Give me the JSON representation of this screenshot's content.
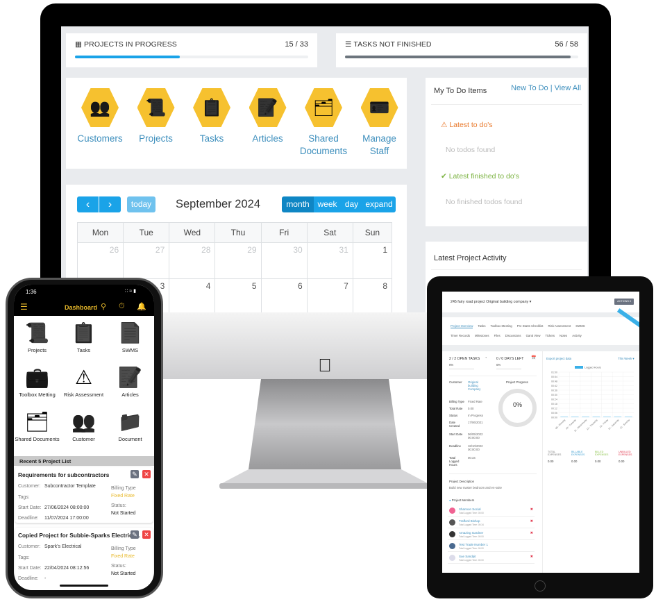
{
  "desktop": {
    "stats": [
      {
        "icon": "cubes-icon",
        "label": "PROJECTS IN PROGRESS",
        "value": "15 / 33",
        "progress": 0.45,
        "color": "#1aa3e8"
      },
      {
        "icon": "tasks-bars-icon",
        "label": "TASKS NOT FINISHED",
        "value": "56 / 58",
        "progress": 0.966,
        "color": "#6c757d"
      }
    ],
    "shortcuts": [
      {
        "label": "Customers",
        "icon": "customers-icon"
      },
      {
        "label": "Projects",
        "icon": "projects-icon"
      },
      {
        "label": "Tasks",
        "icon": "tasks-icon"
      },
      {
        "label": "Articles",
        "icon": "articles-icon"
      },
      {
        "label": "Shared Documents",
        "icon": "shared-documents-icon"
      },
      {
        "label": "Manage Staff",
        "icon": "manage-staff-icon"
      }
    ],
    "todo": {
      "title": "My To Do Items",
      "new_todo": "New To Do",
      "separator": "|",
      "view_all": "View All",
      "latest": "Latest to do's",
      "no_todos": "No todos found",
      "finished": "Latest finished to do's",
      "no_finished": "No finished todos found"
    },
    "activity": {
      "title": "Latest Project Activity"
    },
    "calendar": {
      "prev": "‹",
      "next": "›",
      "today": "today",
      "title": "September 2024",
      "views": [
        "month",
        "week",
        "day",
        "expand"
      ],
      "active_view": "month",
      "weekdays": [
        "Mon",
        "Tue",
        "Wed",
        "Thu",
        "Fri",
        "Sat",
        "Sun"
      ],
      "weeks": [
        [
          "26",
          "27",
          "28",
          "29",
          "30",
          "31",
          "1"
        ],
        [
          "",
          "3",
          "4",
          "5",
          "6",
          "7",
          "8"
        ]
      ]
    }
  },
  "phone": {
    "time": "1:36",
    "title": "Dashboard",
    "tiles": [
      {
        "label": "Projects",
        "icon": "projects-icon"
      },
      {
        "label": "Tasks",
        "icon": "tasks-icon"
      },
      {
        "label": "SWMS",
        "icon": "swms-icon"
      },
      {
        "label": "Toolbox Metting",
        "icon": "toolbox-icon"
      },
      {
        "label": "Risk Assessment",
        "icon": "warning-icon"
      },
      {
        "label": "Articles",
        "icon": "articles-icon"
      },
      {
        "label": "Shared Documents",
        "icon": "shared-documents-icon"
      },
      {
        "label": "Customer",
        "icon": "customers-icon"
      },
      {
        "label": "Document",
        "icon": "folder-icon"
      }
    ],
    "section": "Recent 5 Project List",
    "labels": {
      "customer": "Customer:",
      "tags": "Tags:",
      "start": "Start Date:",
      "deadline": "Deadline:",
      "billing": "Billing Type",
      "status": "Status:"
    },
    "projects": [
      {
        "title": "Requirements for subcontractors",
        "customer": "Subcontractor Template",
        "start": "27/06/2024 08:00:00",
        "deadline": "11/07/2024 17:00:00",
        "billing": "Fixed Rate",
        "status": "Not Started"
      },
      {
        "title": "Copied Project for Subbie-Sparks Electrica...",
        "customer": "Spark's Electrical",
        "start": "22/04/2024 08:12:56",
        "deadline": "-",
        "billing": "Fixed Rate",
        "status": "Not Started"
      }
    ],
    "accent": "#e8b92b"
  },
  "tablet": {
    "title": "245 fairy road project Original building company",
    "title_caret": "▾",
    "actions": "ACTIONS ▾",
    "tabs_row1": [
      "Project Overview",
      "Tasks",
      "Toolbox Meeting",
      "Pre Starts Checklist",
      "Risk Assessment",
      "SWMS"
    ],
    "tabs_row2": [
      "Timer Records",
      "Milestones",
      "Files",
      "Discussions",
      "Gantt View",
      "Tickets",
      "Notes",
      "Activity"
    ],
    "open_tasks": {
      "label": "2 / 2 OPEN TASKS",
      "pct": "0%"
    },
    "days_left": {
      "label": "0 / 0 DAYS LEFT",
      "pct": "0%"
    },
    "details": [
      {
        "k": "Customer",
        "v": "Original building Company"
      },
      {
        "k": "Billing Type",
        "v": "Fixed Rate"
      },
      {
        "k": "Total Rate",
        "v": "0.00"
      },
      {
        "k": "Status",
        "v": "In Progress"
      },
      {
        "k": "Date Created",
        "v": "17/06/2021"
      },
      {
        "k": "Start Date",
        "v": "06/05/2022 00:00:00"
      },
      {
        "k": "Deadline",
        "v": "18/10/2022 00:00:00"
      },
      {
        "k": "Total Logged Hours",
        "v": "00:34"
      }
    ],
    "progress": {
      "label": "Project Progress",
      "value": "0%"
    },
    "export": "Export project data",
    "range": "This Week ▾",
    "description": {
      "title": "Project Description",
      "text": "Build new master bedroom and en-suite"
    },
    "members_title": "Project Members",
    "members": [
      {
        "name": "Shannon Social",
        "sub": "Total Logged Time: 00:00",
        "color": "#f06292",
        "removable": true
      },
      {
        "name": "Trafford Bishop",
        "sub": "Total Logged Time: 00:34",
        "color": "#555555",
        "removable": true
      },
      {
        "name": "Amazing Gardner",
        "sub": "Total Logged Time: 00:00",
        "color": "#333333",
        "removable": true
      },
      {
        "name": "Test Trade Number 1",
        "sub": "Total Logged Time: 00:00",
        "color": "#4a6a90",
        "removable": false
      },
      {
        "name": "Sue Sandpit",
        "sub": "Total Logged Time: 00:00",
        "color": "#dcdcea",
        "removable": true
      }
    ],
    "expenses": [
      {
        "label": "TOTAL EXPENSES",
        "value": "0.00",
        "color": "#777777"
      },
      {
        "label": "BILLABLE EXPENSES",
        "value": "0.00",
        "color": "#3e9fd1"
      },
      {
        "label": "BILLED EXPENSES",
        "value": "0.00",
        "color": "#8bc34a"
      },
      {
        "label": "UNBILLED EXPENSES",
        "value": "0.00",
        "color": "#e0334a"
      }
    ]
  },
  "chart_data": {
    "type": "bar",
    "legend": "Logged Hours",
    "legend_position": "top",
    "categories": [
      "09 - Monday",
      "10 - Tuesday",
      "11 - Wednesday",
      "12 - Thursday",
      "13 - Friday",
      "14 - Saturday",
      "15 - Sunday"
    ],
    "series": [
      {
        "name": "Logged Hours",
        "values": [
          0,
          0,
          0,
          0,
          0,
          0,
          0
        ]
      }
    ],
    "yticks": [
      "00:00",
      "00:06",
      "00:12",
      "00:18",
      "00:24",
      "00:30",
      "00:36",
      "00:42",
      "00:48",
      "00:54",
      "01:00"
    ],
    "ylim": [
      0,
      60
    ],
    "grid": true,
    "color": "#3ab0e8"
  }
}
